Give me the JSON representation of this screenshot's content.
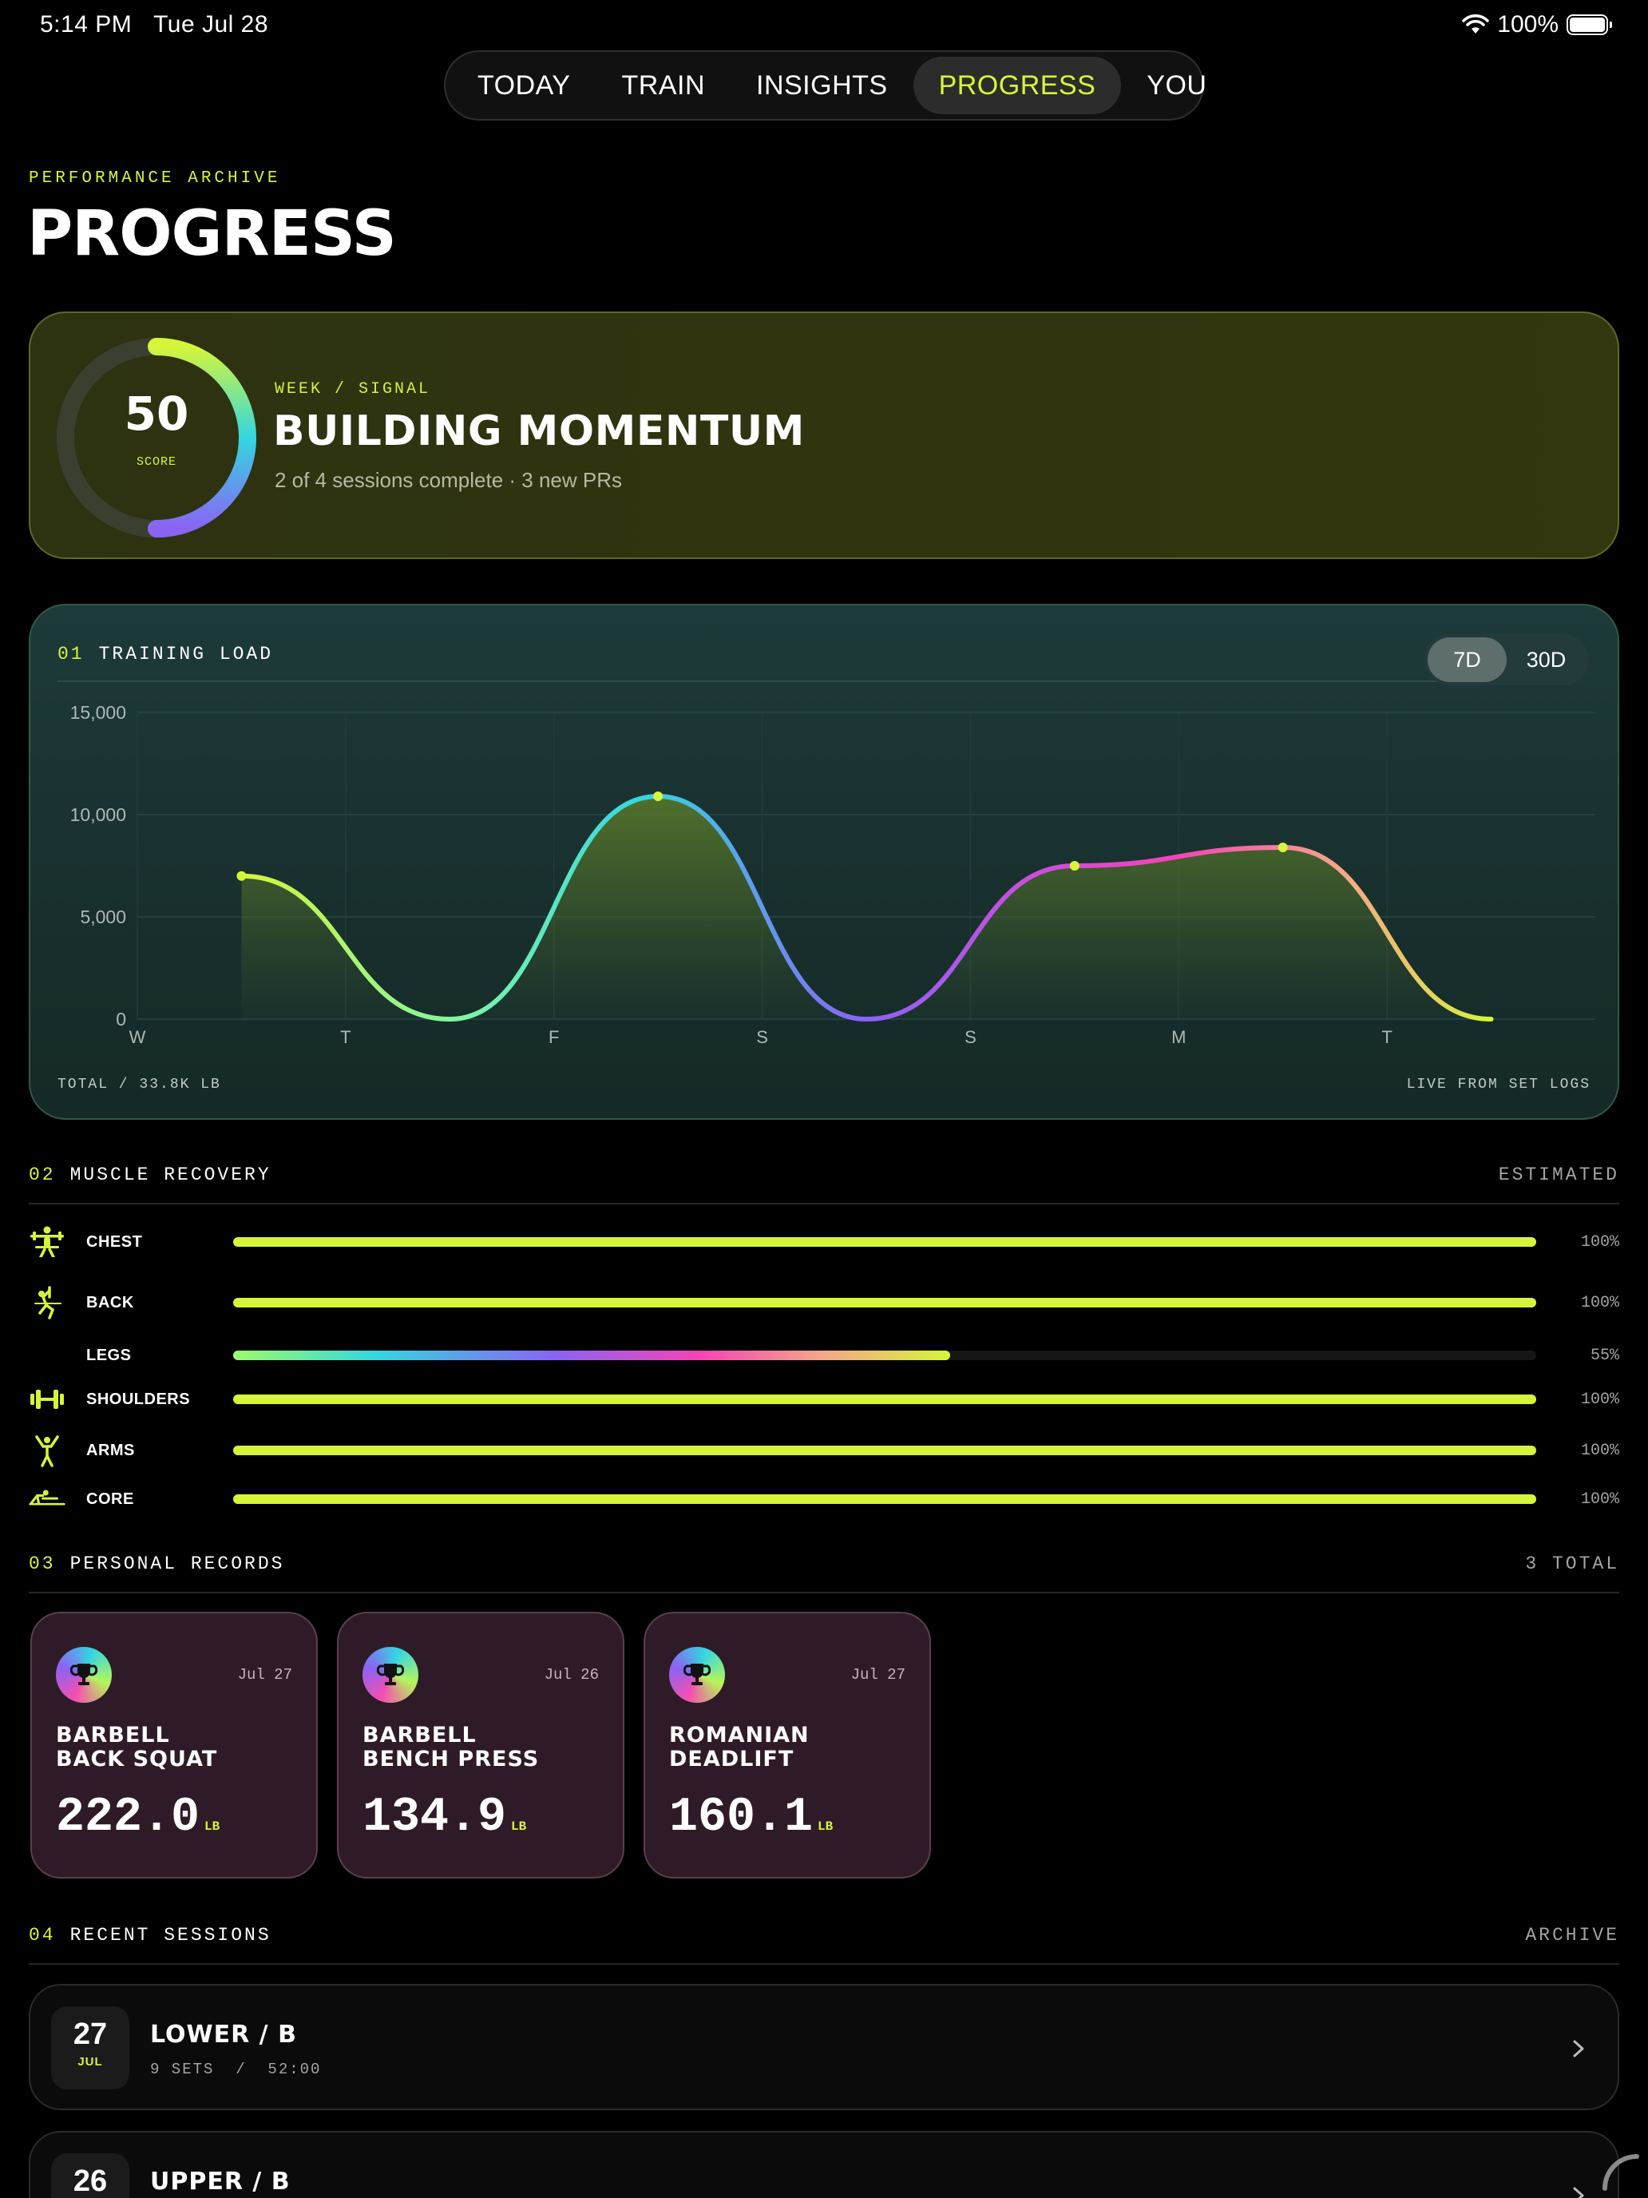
{
  "status_bar": {
    "time": "5:14 PM",
    "date": "Tue Jul 28",
    "battery": "100%"
  },
  "nav": {
    "tabs": [
      {
        "label": "TODAY"
      },
      {
        "label": "TRAIN"
      },
      {
        "label": "INSIGHTS"
      },
      {
        "label": "PROGRESS"
      },
      {
        "label": "YOU"
      }
    ],
    "active": "PROGRESS"
  },
  "header": {
    "eyebrow": "PERFORMANCE ARCHIVE",
    "title": "PROGRESS"
  },
  "signal": {
    "score": "50",
    "score_label": "SCORE",
    "score_fraction": 0.5,
    "eyebrow": "WEEK / SIGNAL",
    "title": "BUILDING MOMENTUM",
    "subtitle": "2 of 4 sessions complete · 3 new PRs"
  },
  "training_load": {
    "section_num": "01",
    "section_title": "TRAINING LOAD",
    "ranges": [
      "7D",
      "30D"
    ],
    "active_range": "7D",
    "footer_left": "TOTAL / 33.8K LB",
    "footer_right": "LIVE FROM SET LOGS"
  },
  "chart_data": {
    "type": "area",
    "categories": [
      "W",
      "T",
      "F",
      "S",
      "S",
      "M",
      "T"
    ],
    "y_ticks": [
      "15,000",
      "10,000",
      "5,000",
      "0"
    ],
    "ylim": [
      0,
      15000
    ],
    "points": [
      {
        "x": 0.5,
        "y": 7000
      },
      {
        "x": 1.5,
        "y": 0
      },
      {
        "x": 2.5,
        "y": 10900
      },
      {
        "x": 3.5,
        "y": 0
      },
      {
        "x": 4.5,
        "y": 7500
      },
      {
        "x": 5.5,
        "y": 8400
      },
      {
        "x": 6.5,
        "y": 0
      }
    ],
    "peak_points": [
      {
        "x": 0.5,
        "y": 7000
      },
      {
        "x": 2.5,
        "y": 10900
      },
      {
        "x": 4.5,
        "y": 7500
      },
      {
        "x": 5.5,
        "y": 8400
      }
    ],
    "grid": true,
    "title": "TRAINING LOAD"
  },
  "recovery": {
    "section_num": "02",
    "section_title": "MUSCLE RECOVERY",
    "right_label": "ESTIMATED",
    "items": [
      {
        "label": "CHEST",
        "pct": "100%",
        "value": 1.0,
        "icon": "bench-press-icon"
      },
      {
        "label": "BACK",
        "pct": "100%",
        "value": 1.0,
        "icon": "pull-up-icon"
      },
      {
        "label": "LEGS",
        "pct": "55%",
        "value": 0.55,
        "icon": ""
      },
      {
        "label": "SHOULDERS",
        "pct": "100%",
        "value": 1.0,
        "icon": "dumbbell-icon"
      },
      {
        "label": "ARMS",
        "pct": "100%",
        "value": 1.0,
        "icon": "person-arms-up-icon"
      },
      {
        "label": "CORE",
        "pct": "100%",
        "value": 1.0,
        "icon": "plank-icon"
      }
    ]
  },
  "records": {
    "section_num": "03",
    "section_title": "PERSONAL RECORDS",
    "right_label": "3 TOTAL",
    "items": [
      {
        "name_line1": "BARBELL",
        "name_line2": "BACK SQUAT",
        "date": "Jul 27",
        "weight": "222.0",
        "unit": "LB"
      },
      {
        "name_line1": "BARBELL",
        "name_line2": "BENCH PRESS",
        "date": "Jul 26",
        "weight": "134.9",
        "unit": "LB"
      },
      {
        "name_line1": "ROMANIAN",
        "name_line2": "DEADLIFT",
        "date": "Jul 27",
        "weight": "160.1",
        "unit": "LB"
      }
    ]
  },
  "sessions": {
    "section_num": "04",
    "section_title": "RECENT SESSIONS",
    "right_label": "ARCHIVE",
    "items": [
      {
        "day": "27",
        "month": "JUL",
        "name": "LOWER / B",
        "meta": "9 SETS  /  52:00"
      },
      {
        "day": "26",
        "month": "",
        "name": "UPPER / B",
        "meta": ""
      }
    ]
  },
  "colors": {
    "accent": "#d6f53a",
    "background": "#000000",
    "signal_card": "#30340f",
    "load_card": "#1b3535",
    "pr_card": "#2f1b27"
  }
}
